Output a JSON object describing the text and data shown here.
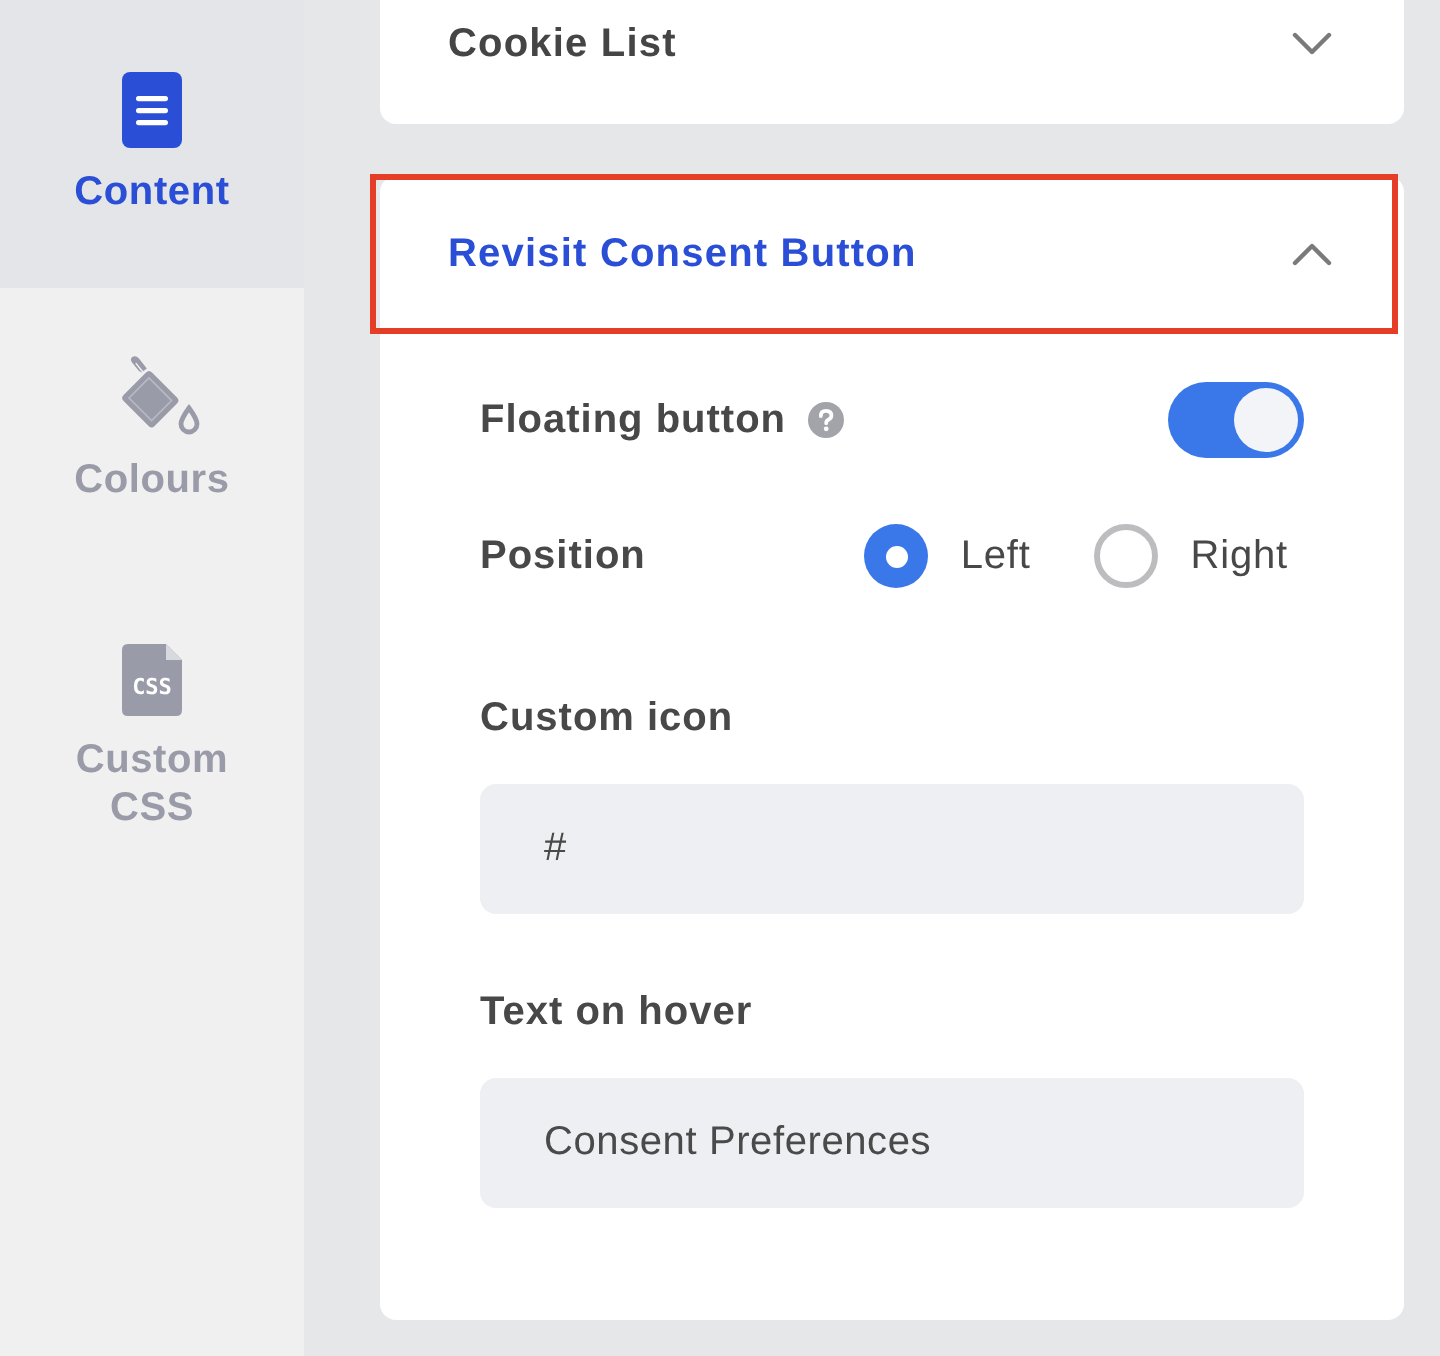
{
  "sidebar": {
    "items": [
      {
        "label": "Content",
        "selected": true
      },
      {
        "label": "Colours",
        "selected": false
      },
      {
        "label": "Custom CSS",
        "selected": false,
        "icon_text": "CSS"
      }
    ]
  },
  "sections": [
    {
      "title": "Cookie List",
      "expanded": false,
      "highlighted": false
    },
    {
      "title": "Revisit Consent Button",
      "expanded": true,
      "highlighted": true,
      "settings": [
        {
          "kind": "toggle",
          "label": "Floating button",
          "help": true,
          "on": true
        },
        {
          "kind": "radio",
          "label": "Position",
          "options": [
            {
              "label": "Left",
              "selected": true
            },
            {
              "label": "Right",
              "selected": false
            }
          ]
        },
        {
          "kind": "text",
          "label": "Custom icon",
          "value": "#"
        },
        {
          "kind": "text",
          "label": "Text on hover",
          "value": "Consent Preferences"
        }
      ]
    }
  ]
}
